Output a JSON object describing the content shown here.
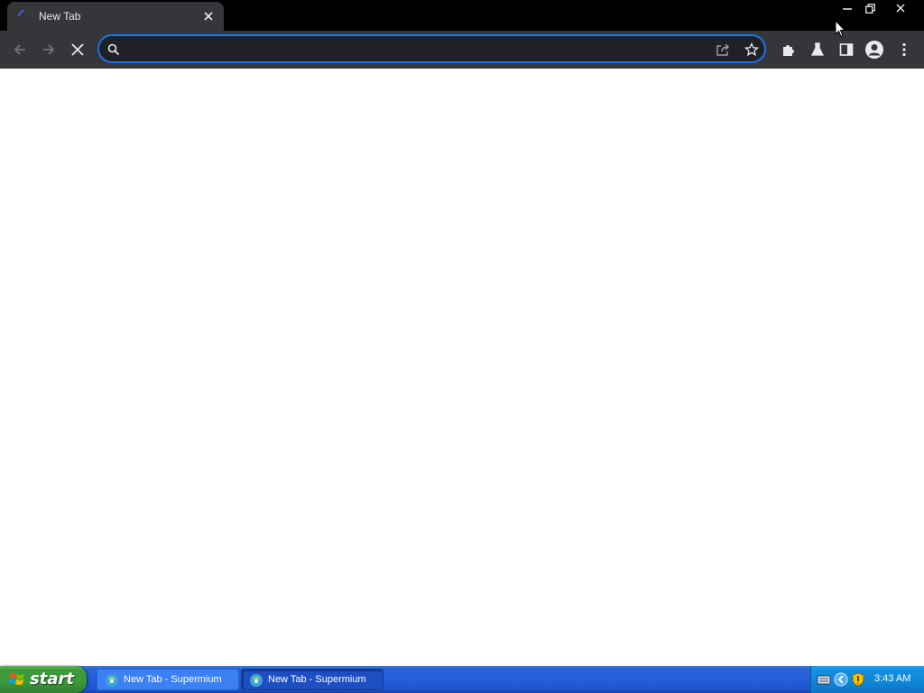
{
  "browser": {
    "tab": {
      "title": "New Tab",
      "favicon": "loading-spinner-icon",
      "close_icon": "close-icon"
    },
    "window_controls": [
      "minimize-icon",
      "restore-icon",
      "close-icon"
    ],
    "toolbar": {
      "back_icon": "back-arrow-icon",
      "forward_icon": "forward-arrow-icon",
      "stop_icon": "stop-loading-icon",
      "omnibox": {
        "value": "",
        "placeholder": "",
        "left_icon": "search-icon",
        "right_icons": [
          "share-icon",
          "bookmark-star-icon"
        ]
      },
      "right_icons": [
        "extensions-puzzle-icon",
        "labs-flask-icon",
        "side-panel-icon",
        "profile-avatar-icon",
        "kebab-menu-icon"
      ]
    },
    "content": {
      "background": "#ffffff"
    }
  },
  "taskbar": {
    "start_label": "start",
    "tasks": [
      {
        "label": "New Tab - Supermium",
        "state": "inactive"
      },
      {
        "label": "New Tab - Supermium",
        "state": "active"
      }
    ],
    "tray": {
      "icons": [
        "keyboard-icon",
        "network-arrow-icon",
        "security-shield-icon"
      ],
      "clock": "3:43 AM"
    }
  },
  "colors": {
    "chrome_dark": "#35363a",
    "titlebar": "#000000",
    "accent_blue": "#1a73e8",
    "xp_taskbar": "#245edb",
    "xp_start_green": "#3c9a3c"
  }
}
